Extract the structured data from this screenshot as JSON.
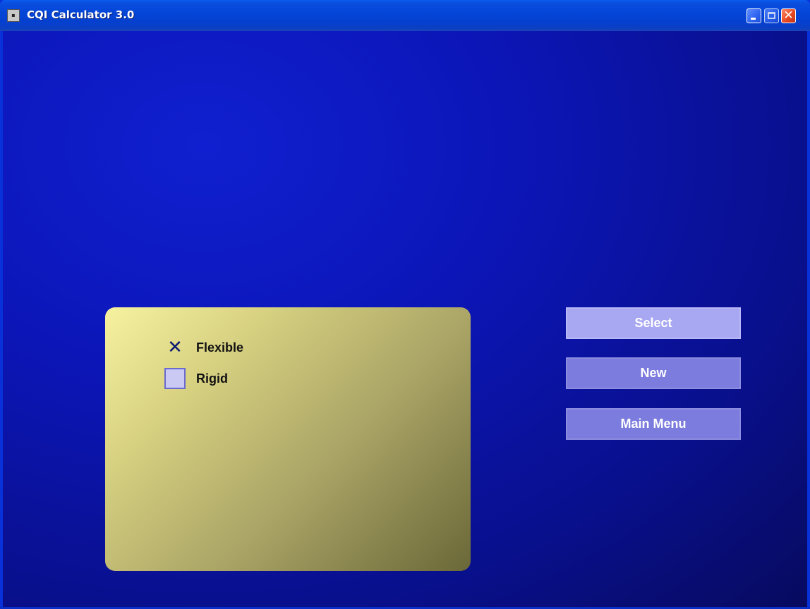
{
  "window": {
    "title": "CQI Calculator 3.0",
    "icon_name": "app-icon",
    "controls": {
      "minimize_icon": "minimize-icon",
      "maximize_icon": "maximize-icon",
      "close_icon": "close-icon",
      "close_glyph": "✕"
    }
  },
  "panel": {
    "options": [
      {
        "label": "Flexible",
        "checked": true,
        "mark": "✕"
      },
      {
        "label": "Rigid",
        "checked": false
      }
    ]
  },
  "actions": {
    "select_label": "Select",
    "new_label": "New",
    "main_menu_label": "Main Menu"
  },
  "colors": {
    "background": "#0c16b8",
    "panel": "#d8d282",
    "button": "#7c7cde",
    "button_active": "#a8a8f2"
  }
}
